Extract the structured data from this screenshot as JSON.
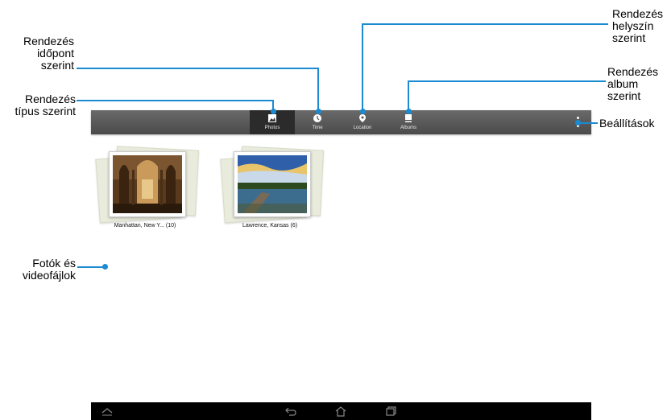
{
  "tabs": [
    {
      "id": "photos",
      "label": "Photos",
      "icon": "image-icon"
    },
    {
      "id": "time",
      "label": "Time",
      "icon": "clock-icon"
    },
    {
      "id": "location",
      "label": "Location",
      "icon": "location-pin-icon"
    },
    {
      "id": "albums",
      "label": "Albums",
      "icon": "album-icon"
    }
  ],
  "albums": [
    {
      "caption": "Manhattan, New Y... (10)"
    },
    {
      "caption": "Lawrence, Kansas (6)"
    }
  ],
  "callouts": {
    "sort_time": "Rendezés\nidőpont\nszerint",
    "sort_type": "Rendezés\ntípus szerint",
    "sort_location": "Rendezés\nhelyszín\nszerint",
    "sort_album": "Rendezés\nalbum\nszerint",
    "settings": "Beállítások",
    "photos_videos": "Fotók és\nvideofájlok"
  },
  "colors": {
    "accent": "#1b8bd1",
    "actionbar": "#555555",
    "navbar": "#000000"
  }
}
